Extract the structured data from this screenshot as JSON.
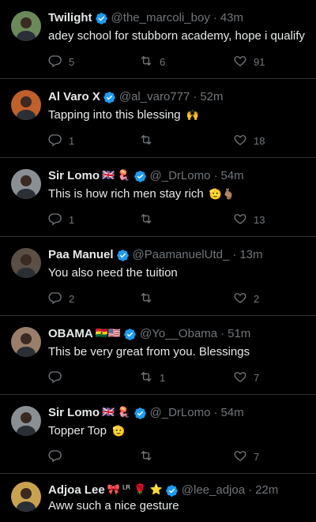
{
  "tweets": [
    {
      "name": "Twilight",
      "handle": "@the_marcoli_boy",
      "time": "43m",
      "text": "adey school for stubborn academy, hope i qualify",
      "emoji": "",
      "text_emoji": "",
      "replies": "5",
      "retweets": "6",
      "likes": "91",
      "avatar_color": "#6b8a5a"
    },
    {
      "name": "Al Varo X",
      "handle": "@al_varo777",
      "time": "52m",
      "text": "Tapping into this blessing",
      "emoji": "",
      "text_emoji": "🙌",
      "replies": "1",
      "retweets": "",
      "likes": "18",
      "avatar_color": "#c0602a"
    },
    {
      "name": "Sir Lomo",
      "handle": "@_DrLomo",
      "time": "54m",
      "text": "This is how rich men stay rich",
      "emoji": "🇬🇧 🪼",
      "text_emoji": "🫡🫰🏽",
      "replies": "1",
      "retweets": "",
      "likes": "13",
      "avatar_color": "#8a8f94"
    },
    {
      "name": "Paa Manuel",
      "handle": "@PaamanuelUtd_",
      "time": "13m",
      "text": "You also need the tuition",
      "emoji": "",
      "text_emoji": "",
      "replies": "2",
      "retweets": "",
      "likes": "2",
      "avatar_color": "#5a4e45"
    },
    {
      "name": "OBAMA",
      "handle": "@Yo__Obama",
      "time": "51m",
      "text": "This be very great from you. Blessings",
      "emoji": "🇬🇭🇺🇸",
      "text_emoji": "",
      "replies": "",
      "retweets": "1",
      "likes": "7",
      "avatar_color": "#9a7e6a"
    },
    {
      "name": "Sir Lomo",
      "handle": "@_DrLomo",
      "time": "54m",
      "text": "Topper Top",
      "emoji": "🇬🇧 🪼",
      "text_emoji": "🫡",
      "replies": "",
      "retweets": "",
      "likes": "7",
      "avatar_color": "#8a8f94"
    },
    {
      "name": "Adjoa Lee",
      "handle": "@lee_adjoa",
      "time": "22m",
      "text": "Aww such a nice gesture",
      "emoji": "🎀",
      "suffix_emoji": "ᴸᴿ 🌹 ⭐",
      "text_emoji": "",
      "replies": "",
      "retweets": "",
      "likes": "",
      "avatar_color": "#c9a24f"
    }
  ],
  "colors": {
    "verified": "#1d9bf0",
    "muted": "#71767b",
    "text": "#e7e9ea",
    "bg": "#000000",
    "divider": "#2f3336"
  },
  "icons": {
    "reply": "reply-icon",
    "retweet": "retweet-icon",
    "like": "heart-icon",
    "verified": "verified-badge-icon"
  }
}
